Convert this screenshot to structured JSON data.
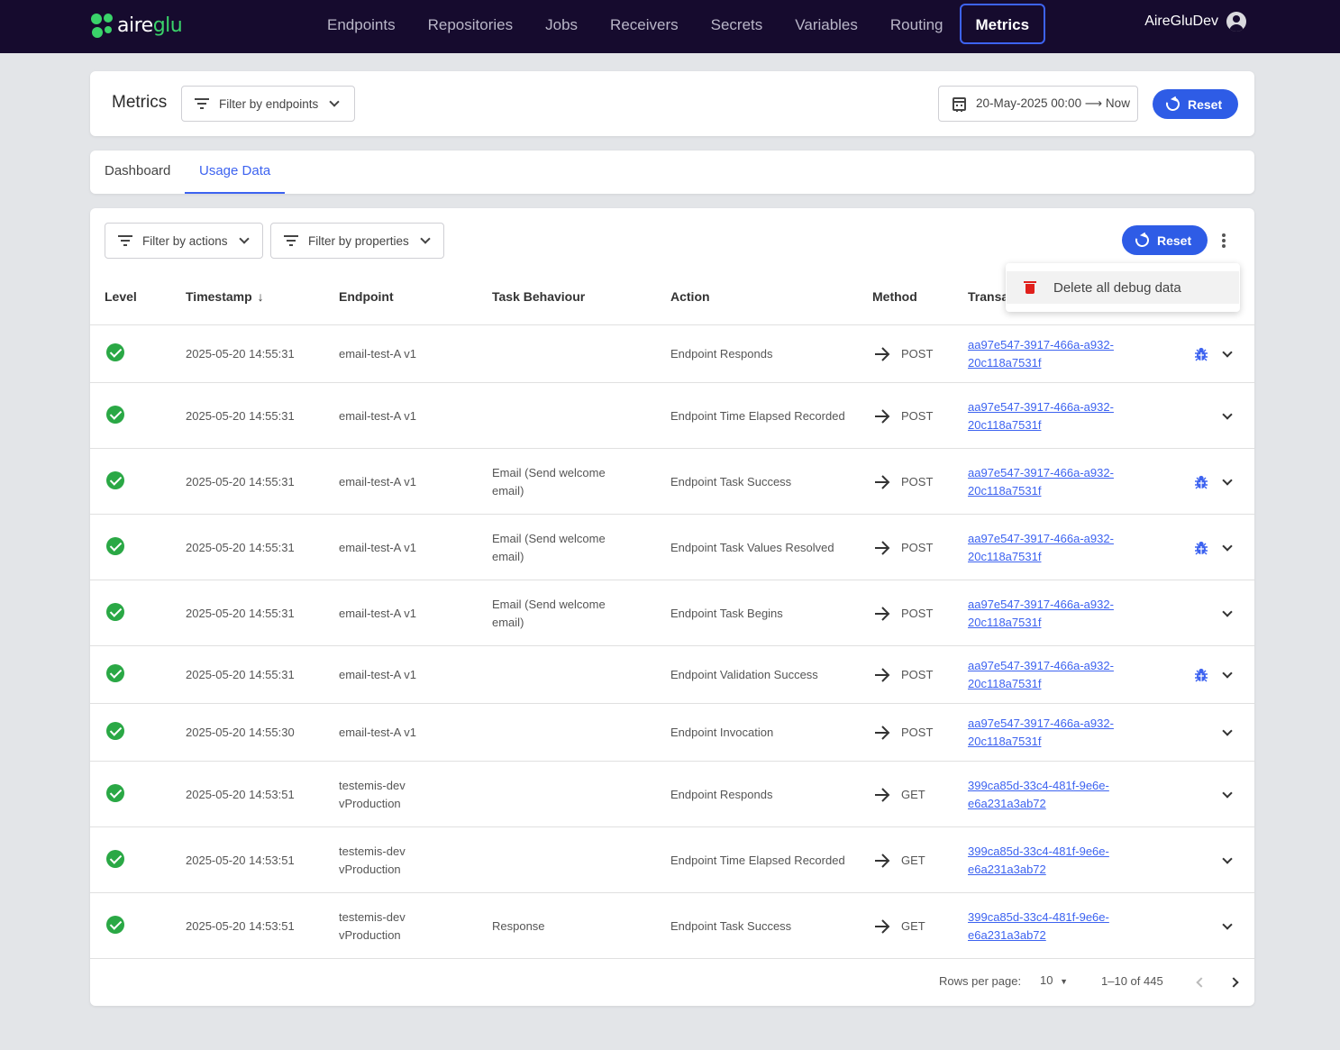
{
  "app": {
    "logo": {
      "part1": "aire",
      "part2": "glu"
    },
    "nav": [
      "Endpoints",
      "Repositories",
      "Jobs",
      "Receivers",
      "Secrets",
      "Variables",
      "Routing",
      "Metrics"
    ],
    "active_nav": "Metrics",
    "user": "AireGluDev"
  },
  "header": {
    "title": "Metrics",
    "filter_endpoints": "Filter by endpoints",
    "date_range": "20-May-2025 00:00 ⟶ Now",
    "reset": "Reset"
  },
  "tabs": [
    "Dashboard",
    "Usage Data"
  ],
  "active_tab": "Usage Data",
  "table_toolbar": {
    "filter_actions": "Filter by actions",
    "filter_properties": "Filter by properties",
    "reset": "Reset"
  },
  "menu": {
    "delete_all": "Delete all debug data"
  },
  "columns": {
    "level": "Level",
    "timestamp": "Timestamp",
    "endpoint": "Endpoint",
    "task": "Task Behaviour",
    "action": "Action",
    "method": "Method",
    "transaction": "Transac"
  },
  "rows": [
    {
      "level": "success",
      "timestamp": "2025-05-20 14:55:31",
      "endpoint": "email-test-A v1",
      "task": "",
      "action": "Endpoint Responds",
      "method": "POST",
      "tx": "aa97e547-3917-466a-a932-20c118a7531f",
      "debug": true
    },
    {
      "level": "success",
      "timestamp": "2025-05-20 14:55:31",
      "endpoint": "email-test-A v1",
      "task": "",
      "action": "Endpoint Time Elapsed Recorded",
      "method": "POST",
      "tx": "aa97e547-3917-466a-a932-20c118a7531f",
      "debug": false
    },
    {
      "level": "success",
      "timestamp": "2025-05-20 14:55:31",
      "endpoint": "email-test-A v1",
      "task": "Email (Send welcome email)",
      "action": "Endpoint Task Success",
      "method": "POST",
      "tx": "aa97e547-3917-466a-a932-20c118a7531f",
      "debug": true
    },
    {
      "level": "success",
      "timestamp": "2025-05-20 14:55:31",
      "endpoint": "email-test-A v1",
      "task": "Email (Send welcome email)",
      "action": "Endpoint Task Values Resolved",
      "method": "POST",
      "tx": "aa97e547-3917-466a-a932-20c118a7531f",
      "debug": true
    },
    {
      "level": "success",
      "timestamp": "2025-05-20 14:55:31",
      "endpoint": "email-test-A v1",
      "task": "Email (Send welcome email)",
      "action": "Endpoint Task Begins",
      "method": "POST",
      "tx": "aa97e547-3917-466a-a932-20c118a7531f",
      "debug": false
    },
    {
      "level": "success",
      "timestamp": "2025-05-20 14:55:31",
      "endpoint": "email-test-A v1",
      "task": "",
      "action": "Endpoint Validation Success",
      "method": "POST",
      "tx": "aa97e547-3917-466a-a932-20c118a7531f",
      "debug": true
    },
    {
      "level": "success",
      "timestamp": "2025-05-20 14:55:30",
      "endpoint": "email-test-A v1",
      "task": "",
      "action": "Endpoint Invocation",
      "method": "POST",
      "tx": "aa97e547-3917-466a-a932-20c118a7531f",
      "debug": false
    },
    {
      "level": "success",
      "timestamp": "2025-05-20 14:53:51",
      "endpoint": "testemis-dev vProduction",
      "task": "",
      "action": "Endpoint Responds",
      "method": "GET",
      "tx": "399ca85d-33c4-481f-9e6e-e6a231a3ab72",
      "debug": false
    },
    {
      "level": "success",
      "timestamp": "2025-05-20 14:53:51",
      "endpoint": "testemis-dev vProduction",
      "task": "",
      "action": "Endpoint Time Elapsed Recorded",
      "method": "GET",
      "tx": "399ca85d-33c4-481f-9e6e-e6a231a3ab72",
      "debug": false
    },
    {
      "level": "success",
      "timestamp": "2025-05-20 14:53:51",
      "endpoint": "testemis-dev vProduction",
      "task": "Response",
      "action": "Endpoint Task Success",
      "method": "GET",
      "tx": "399ca85d-33c4-481f-9e6e-e6a231a3ab72",
      "debug": false
    }
  ],
  "pagination": {
    "rows_per_page_label": "Rows per page:",
    "rows_per_page": "10",
    "range": "1–10 of 445"
  },
  "colors": {
    "accent": "#3d63f0",
    "navbar": "#160b2e",
    "success": "#2aa845",
    "danger": "#e0201c"
  }
}
